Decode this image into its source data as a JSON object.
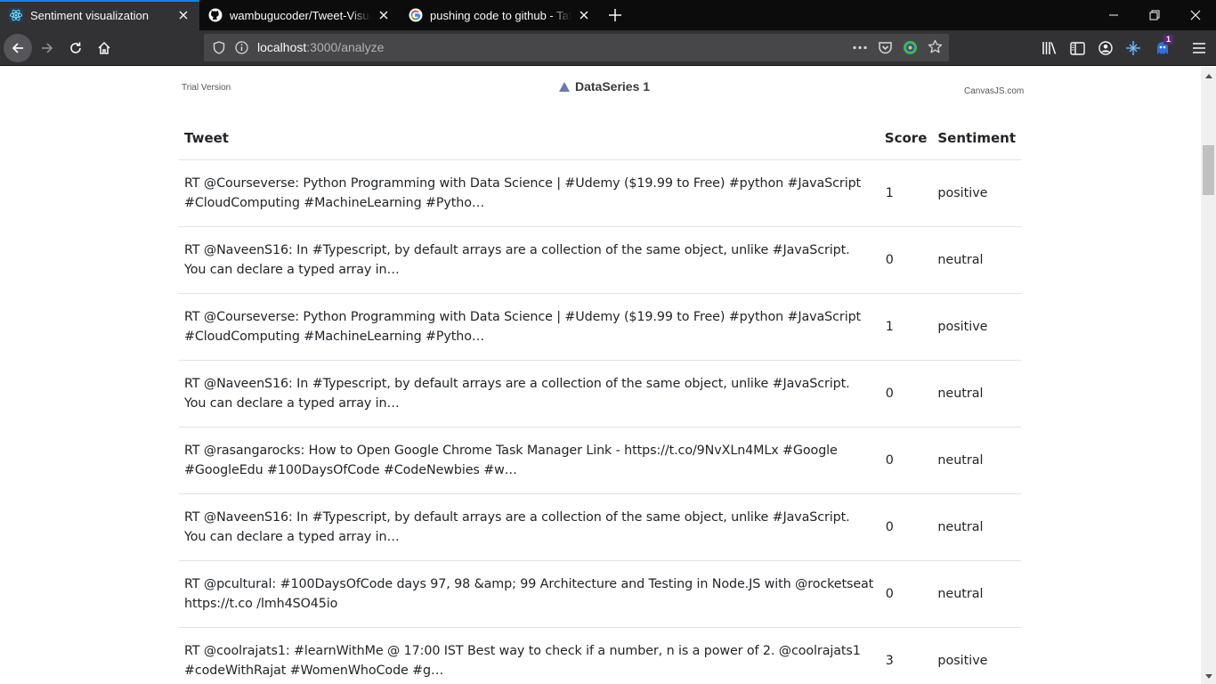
{
  "browser": {
    "tabs": [
      {
        "title": "Sentiment visualization",
        "icon": "react-icon",
        "active": true
      },
      {
        "title": "wambugucoder/Tweet-Visualiz",
        "icon": "github-icon",
        "active": false
      },
      {
        "title": "pushing code to github - Tafut",
        "icon": "google-icon",
        "active": false
      }
    ],
    "url_host": "localhost",
    "url_path": ":3000/analyze",
    "extension_badge": "1",
    "accent": "#0a84ff"
  },
  "chart": {
    "trial_label": "Trial Version",
    "legend_label": "DataSeries 1",
    "credit": "CanvasJS.com",
    "series_color": "#6d78ad"
  },
  "table": {
    "headers": {
      "tweet": "Tweet",
      "score": "Score",
      "sentiment": "Sentiment"
    },
    "rows": [
      {
        "tweet": "RT @Courseverse: Python Programming with Data Science | #Udemy ($19.99 to Free) #python #JavaScript #CloudComputing #MachineLearning #Pytho…",
        "score": "1",
        "sentiment": "positive"
      },
      {
        "tweet": "RT @NaveenS16: In #Typescript, by default arrays are a collection of the same object, unlike #JavaScript. You can declare a typed array in…",
        "score": "0",
        "sentiment": "neutral"
      },
      {
        "tweet": "RT @Courseverse: Python Programming with Data Science | #Udemy ($19.99 to Free) #python #JavaScript #CloudComputing #MachineLearning #Pytho…",
        "score": "1",
        "sentiment": "positive"
      },
      {
        "tweet": "RT @NaveenS16: In #Typescript, by default arrays are a collection of the same object, unlike #JavaScript. You can declare a typed array in…",
        "score": "0",
        "sentiment": "neutral"
      },
      {
        "tweet": "RT @rasangarocks: How to Open Google Chrome Task Manager Link - https://t.co/9NvXLn4MLx #Google #GoogleEdu #100DaysOfCode #CodeNewbies #w…",
        "score": "0",
        "sentiment": "neutral"
      },
      {
        "tweet": "RT @NaveenS16: In #Typescript, by default arrays are a collection of the same object, unlike #JavaScript. You can declare a typed array in…",
        "score": "0",
        "sentiment": "neutral"
      },
      {
        "tweet": "RT @pcultural: #100DaysOfCode days 97, 98 &amp; 99 Architecture and Testing in Node.JS with @rocketseat https://t.co /lmh4SO45io",
        "score": "0",
        "sentiment": "neutral"
      },
      {
        "tweet": "RT @coolrajats1: #learnWithMe @ 17:00 IST Best way to check if a number, n is a power of 2. @coolrajats1 #codeWithRajat #WomenWhoCode #g…",
        "score": "3",
        "sentiment": "positive"
      }
    ]
  }
}
